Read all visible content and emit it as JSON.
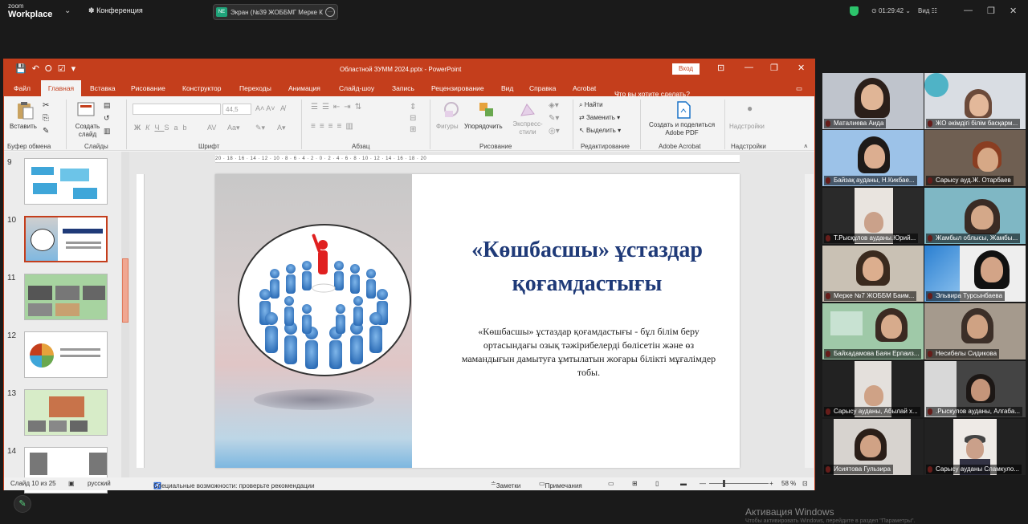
{
  "zoom": {
    "brand_line1": "zoom",
    "brand_line2": "Workplace",
    "conference_label": "Конференция",
    "share_badge": "NE",
    "share_title": "Экран (№39 ЖОББМГ Мерке К",
    "timer": "01:29:42",
    "view_label": "Вид"
  },
  "ppt": {
    "file_title": "Областной ЗУММ 2024.pptx  -  PowerPoint",
    "login_button": "Вход",
    "tabs": [
      "Файл",
      "Главная",
      "Вставка",
      "Рисование",
      "Конструктор",
      "Переходы",
      "Анимация",
      "Слайд-шоу",
      "Запись",
      "Рецензирование",
      "Вид",
      "Справка",
      "Acrobat"
    ],
    "search_hint": "Что вы хотите сделать?",
    "ribbon": {
      "paste": "Вставить",
      "create_slide": "Создать слайд",
      "font_size": "44,5",
      "find": "Найти",
      "replace": "Заменить",
      "select": "Выделить",
      "shapes": "Фигуры",
      "arrange": "Упорядочить",
      "quick_styles": "Экспресс-стили",
      "acrobat_btn": "Создать и поделиться Adobe PDF",
      "addins_btn": "Надстройки",
      "groups": [
        "Буфер обмена",
        "Слайды",
        "Шрифт",
        "Абзац",
        "Рисование",
        "Редактирование",
        "Adobe Acrobat",
        "Надстройки"
      ]
    },
    "thumb_numbers": [
      "9",
      "10",
      "11",
      "12",
      "13",
      "14"
    ],
    "slide": {
      "title": "«Көшбасшы» ұстаздар қоғамдастығы",
      "body": "«Көшбасшы» ұстаздар қоғамдастығы - бұл білім беру ортасындағы озық тәжірибелерді бөлісетін және өз мамандығын дамытуға ұмтылатын жоғары білікті мұғалімдер тобы."
    },
    "ruler_labels": "20 · 18 · 16 · 14 · 12 · 10 · 8 · 6 · 4 · 2 · 0 · 2 · 4 · 6 · 8 · 10 · 12 · 14 · 16 · 18 · 20",
    "status": {
      "slide_of": "Слайд 10 из 25",
      "language": "русский",
      "accessibility": "Специальные возможности: проверьте рекомендации",
      "notes": "Заметки",
      "comments": "Примечания",
      "zoom": "58 %"
    }
  },
  "participants": [
    "Маталиева Аида",
    "ЖО әкімдігі білім басқарм...",
    "Байзақ ауданы, Н.Кикбае...",
    "Сарысу ауд.Ж. Отарбаев",
    "Т.Рысқұлов ауданы.Юрий...",
    "Жамбыл облысы, Жамбы...",
    "Мерке №7 ЖОББМ Баим...",
    "Эльвира Турсынбаева",
    "Байхадамова Баян Ерпаиз...",
    "Несибелы Сидикова",
    "Сарысу ауданы, Абылай х...",
    ".Рыскулов ауданы, Алгаба...",
    "Исиятова Гульзира",
    "Сарысу ауданы Сламкуло..."
  ],
  "windows": {
    "activate_title": "Активация Windows",
    "activate_sub": "Чтобы активировать Windows, перейдите в раздел \"Параметры\"."
  }
}
